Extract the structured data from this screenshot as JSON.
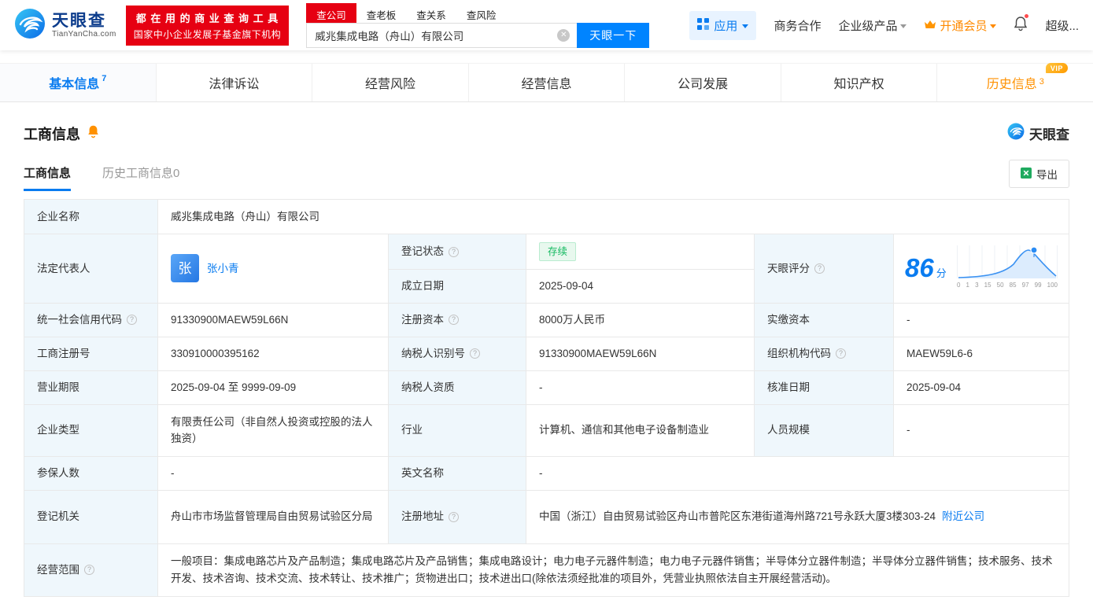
{
  "header": {
    "logo_title": "天眼查",
    "logo_sub": "TianYanCha.com",
    "banner_line1": "都 在 用 的 商 业 查 询 工 具",
    "banner_line2": "国家中小企业发展子基金旗下机构",
    "search_tabs": [
      "查公司",
      "查老板",
      "查关系",
      "查风险"
    ],
    "search_value": "威兆集成电路（舟山）有限公司",
    "search_button": "天眼一下",
    "nav": {
      "apps": "应用",
      "biz": "商务合作",
      "enterprise": "企业级产品",
      "vip": "开通会员",
      "super": "超级..."
    }
  },
  "tabs": [
    {
      "label": "基本信息",
      "count": "7"
    },
    {
      "label": "法律诉讼"
    },
    {
      "label": "经营风险"
    },
    {
      "label": "经营信息"
    },
    {
      "label": "公司发展"
    },
    {
      "label": "知识产权"
    },
    {
      "label": "历史信息",
      "count": "3",
      "badge": "VIP"
    }
  ],
  "section": {
    "title": "工商信息",
    "watermark": "天眼查",
    "subtabs": [
      {
        "label": "工商信息"
      },
      {
        "label": "历史工商信息0"
      }
    ],
    "export_label": "导出"
  },
  "info": {
    "company_name_label": "企业名称",
    "company_name": "威兆集成电路（舟山）有限公司",
    "legal_rep_label": "法定代表人",
    "legal_rep_avatar": "张",
    "legal_rep": "张小青",
    "reg_status_label": "登记状态",
    "reg_status": "存续",
    "establish_date_label": "成立日期",
    "establish_date": "2025-09-04",
    "score_label": "天眼评分",
    "score": "86",
    "score_unit": "分",
    "credit_code_label": "统一社会信用代码",
    "credit_code": "91330900MAEW59L66N",
    "reg_capital_label": "注册资本",
    "reg_capital": "8000万人民币",
    "paid_capital_label": "实缴资本",
    "paid_capital": "-",
    "reg_number_label": "工商注册号",
    "reg_number": "330910000395162",
    "taxpayer_id_label": "纳税人识别号",
    "taxpayer_id": "91330900MAEW59L66N",
    "org_code_label": "组织机构代码",
    "org_code": "MAEW59L6-6",
    "business_term_label": "营业期限",
    "business_term": "2025-09-04 至 9999-09-09",
    "taxpayer_quality_label": "纳税人资质",
    "taxpayer_quality": "-",
    "approval_date_label": "核准日期",
    "approval_date": "2025-09-04",
    "company_type_label": "企业类型",
    "company_type": "有限责任公司（非自然人投资或控股的法人独资）",
    "industry_label": "行业",
    "industry": "计算机、通信和其他电子设备制造业",
    "staff_size_label": "人员规模",
    "staff_size": "-",
    "insured_label": "参保人数",
    "insured": "-",
    "english_name_label": "英文名称",
    "english_name": "-",
    "reg_authority_label": "登记机关",
    "reg_authority": "舟山市市场监督管理局自由贸易试验区分局",
    "address_label": "注册地址",
    "address": "中国（浙江）自由贸易试验区舟山市普陀区东港街道海州路721号永跃大厦3楼303-24",
    "nearby_link": "附近公司",
    "scope_label": "经营范围",
    "scope": "一般项目：集成电路芯片及产品制造；集成电路芯片及产品销售；集成电路设计；电力电子元器件制造；电力电子元器件销售；半导体分立器件制造；半导体分立器件销售；技术服务、技术开发、技术咨询、技术交流、技术转让、技术推广；货物进出口；技术进出口(除依法须经批准的项目外，凭营业执照依法自主开展经营活动)。"
  },
  "score_chart": {
    "ticks": [
      "0",
      "1",
      "3",
      "15",
      "50",
      "85",
      "97",
      "99",
      "100"
    ]
  }
}
